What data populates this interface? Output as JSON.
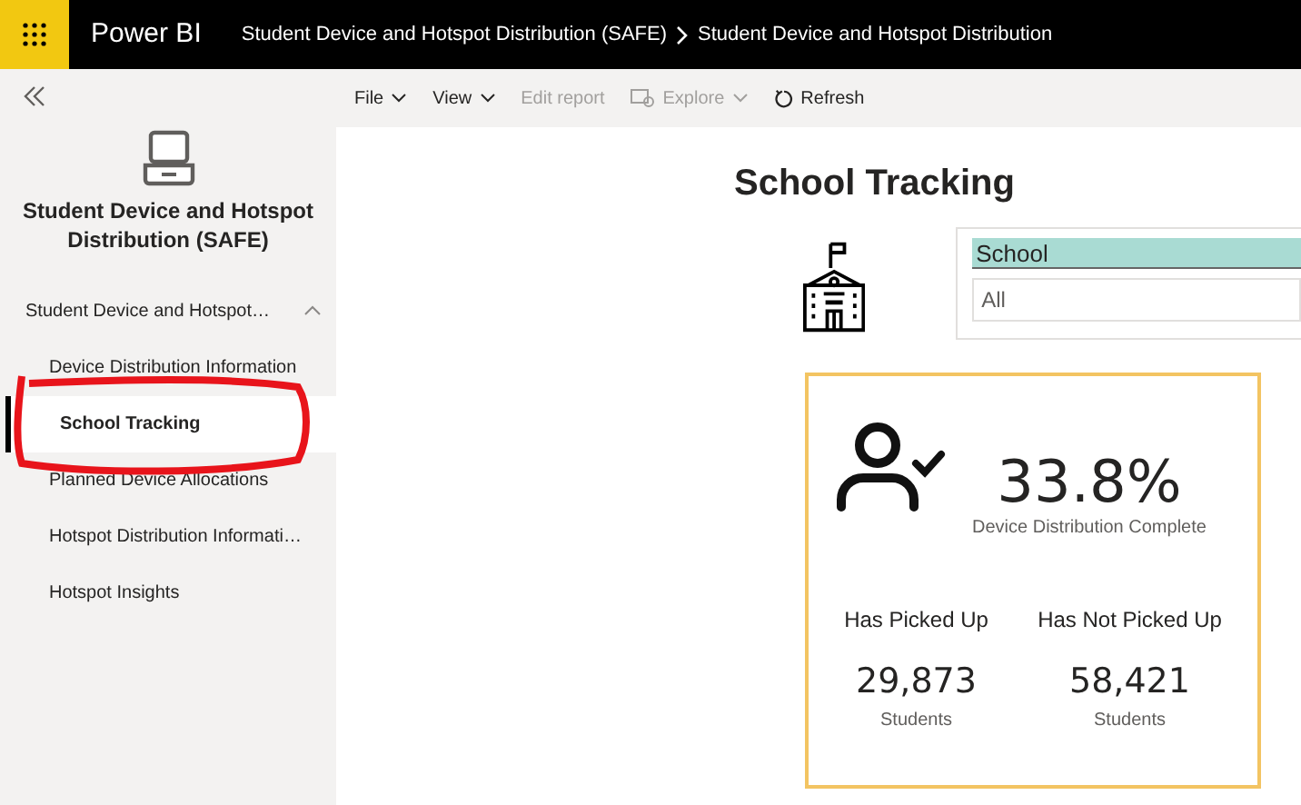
{
  "header": {
    "app_name": "Power BI",
    "breadcrumb": [
      {
        "label": "Student Device and Hotspot Distribution (SAFE)"
      },
      {
        "label": "Student Device and Hotspot Distribution"
      }
    ]
  },
  "toolbar": [
    {
      "label": "File",
      "disabled": false,
      "kind": "menu"
    },
    {
      "label": "View",
      "disabled": false,
      "kind": "menu"
    },
    {
      "label": "Edit report",
      "disabled": true,
      "kind": "plain"
    },
    {
      "label": "Explore",
      "disabled": true,
      "kind": "explore"
    },
    {
      "label": "Refresh",
      "disabled": false,
      "kind": "refresh"
    }
  ],
  "sidebar": {
    "workspace_title": "Student Device and Hotspot Distribution (SAFE)",
    "section": {
      "label": "Student Device and Hotspot…",
      "expanded": true
    },
    "items": [
      {
        "label": "Device Distribution Information",
        "selected": false
      },
      {
        "label": "School Tracking",
        "selected": true
      },
      {
        "label": "Planned Device Allocations",
        "selected": false
      },
      {
        "label": "Hotspot Distribution Informati…",
        "selected": false
      },
      {
        "label": "Hotspot Insights",
        "selected": false
      }
    ]
  },
  "report": {
    "title": "School Tracking",
    "slicer": {
      "header": "School",
      "value": "All"
    },
    "card": {
      "percent": "33.8%",
      "percent_label": "Device Distribution Complete",
      "stats": [
        {
          "label": "Has Picked Up",
          "value": "29,873",
          "unit": "Students"
        },
        {
          "label": "Has Not Picked Up",
          "value": "58,421",
          "unit": "Students"
        }
      ]
    }
  }
}
